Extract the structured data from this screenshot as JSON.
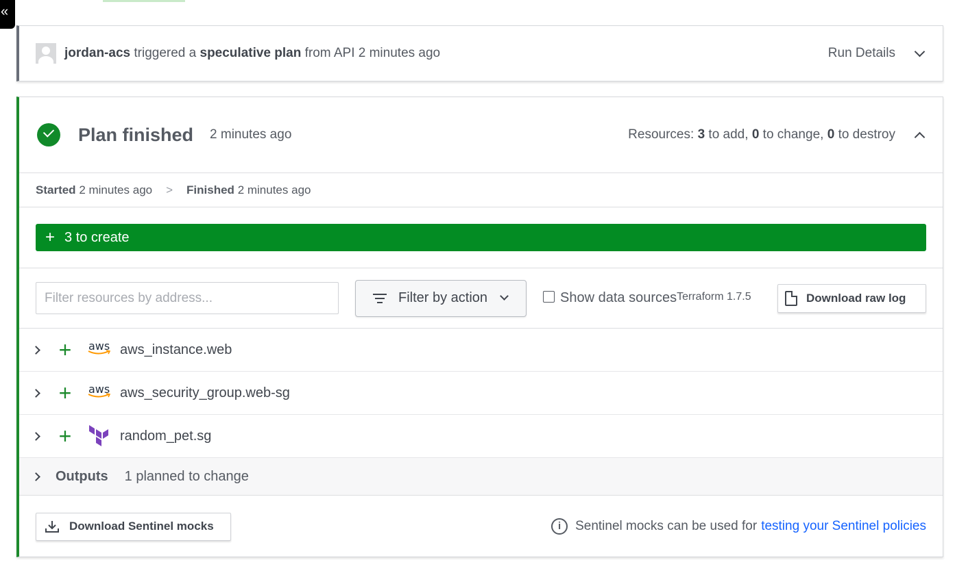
{
  "sidebar_toggle": {
    "glyph": "«"
  },
  "run": {
    "user": "jordan-acs",
    "verb": "triggered a",
    "plan_type": "speculative plan",
    "source": "from API 2 minutes ago",
    "details_label": "Run Details"
  },
  "plan": {
    "title": "Plan finished",
    "time": "2 minutes ago",
    "resources_prefix": "Resources:",
    "add_count": "3",
    "add_label": "to add,",
    "change_count": "0",
    "change_label": "to change,",
    "destroy_count": "0",
    "destroy_label": "to destroy",
    "started_label": "Started",
    "started_time": "2 minutes ago",
    "timeline_sep": ">",
    "finished_label": "Finished",
    "finished_time": "2 minutes ago",
    "create_label": "3 to create",
    "create_symbol": "+"
  },
  "filters": {
    "search_placeholder": "Filter resources by address...",
    "action_label": "Filter by action",
    "data_sources_label": "Show data sources",
    "terraform_version": "Terraform 1.7.5",
    "download_log_label": "Download raw log"
  },
  "resources": [
    {
      "name": "aws_instance.web",
      "provider": "aws"
    },
    {
      "name": "aws_security_group.web-sg",
      "provider": "aws"
    },
    {
      "name": "random_pet.sg",
      "provider": "terraform"
    }
  ],
  "resource_action_symbol": "+",
  "aws_logo_text": "aws",
  "outputs": {
    "label": "Outputs",
    "summary": "1 planned to change"
  },
  "footer": {
    "mocks_button": "Download Sentinel mocks",
    "info_text": "Sentinel mocks can be used for",
    "info_link": "testing your Sentinel policies",
    "info_glyph": "i"
  },
  "colors": {
    "success": "#038c23",
    "link": "#1563ff",
    "run_border": "#6a6f79"
  }
}
